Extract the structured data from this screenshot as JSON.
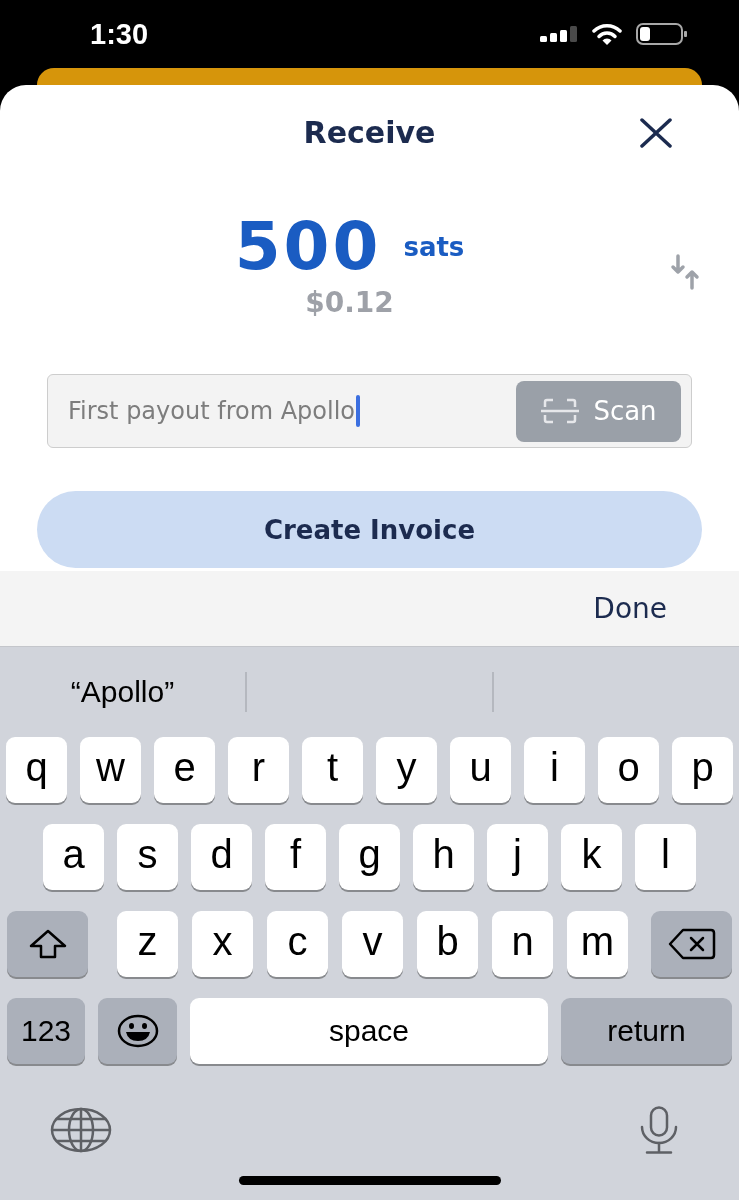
{
  "status_bar": {
    "time": "1:30"
  },
  "sheet": {
    "title": "Receive"
  },
  "amount": {
    "value": "500",
    "unit": "sats",
    "fiat": "$0.12"
  },
  "memo_field": {
    "value": "First payout from Apollo",
    "focused": true
  },
  "scan_button": {
    "label": "Scan"
  },
  "create_button": {
    "label": "Create Invoice"
  },
  "keyboard_toolbar": {
    "done_button": "Done"
  },
  "keyboard": {
    "suggestions": [
      "“Apollo”"
    ],
    "key_rows": [
      {
        "keys": [
          {
            "kind": "letter",
            "label": "q"
          },
          {
            "kind": "letter",
            "label": "w"
          },
          {
            "kind": "letter",
            "label": "e"
          },
          {
            "kind": "letter",
            "label": "r"
          },
          {
            "kind": "letter",
            "label": "t"
          },
          {
            "kind": "letter",
            "label": "y"
          },
          {
            "kind": "letter",
            "label": "u"
          },
          {
            "kind": "letter",
            "label": "i"
          },
          {
            "kind": "letter",
            "label": "o"
          },
          {
            "kind": "letter",
            "label": "p"
          }
        ]
      },
      {
        "keys": [
          {
            "kind": "letter",
            "label": "a"
          },
          {
            "kind": "letter",
            "label": "s"
          },
          {
            "kind": "letter",
            "label": "d"
          },
          {
            "kind": "letter",
            "label": "f"
          },
          {
            "kind": "letter",
            "label": "g"
          },
          {
            "kind": "letter",
            "label": "h"
          },
          {
            "kind": "letter",
            "label": "j"
          },
          {
            "kind": "letter",
            "label": "k"
          },
          {
            "kind": "letter",
            "label": "l"
          }
        ]
      },
      {
        "keys": [
          {
            "kind": "shift"
          },
          {
            "kind": "letter",
            "label": "z"
          },
          {
            "kind": "letter",
            "label": "x"
          },
          {
            "kind": "letter",
            "label": "c"
          },
          {
            "kind": "letter",
            "label": "v"
          },
          {
            "kind": "letter",
            "label": "b"
          },
          {
            "kind": "letter",
            "label": "n"
          },
          {
            "kind": "letter",
            "label": "m"
          },
          {
            "kind": "delete"
          }
        ]
      },
      {
        "keys": [
          {
            "kind": "numbers",
            "label": "123"
          },
          {
            "kind": "emoji"
          },
          {
            "kind": "space",
            "label": "space"
          },
          {
            "kind": "return",
            "label": "return"
          }
        ]
      }
    ]
  }
}
